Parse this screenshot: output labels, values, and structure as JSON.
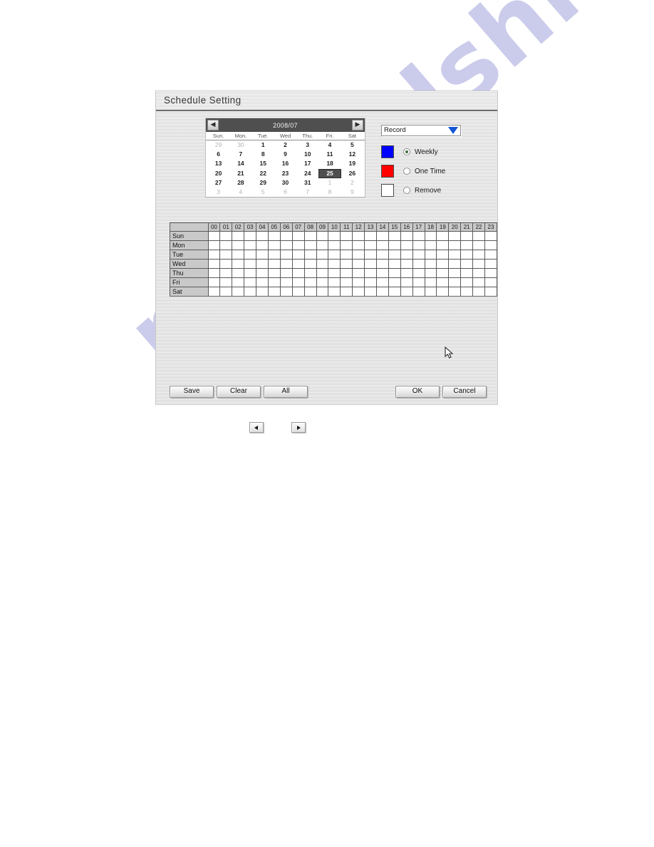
{
  "watermark": {
    "text": "manualshive.com"
  },
  "dialog": {
    "title": "Schedule Setting"
  },
  "calendar": {
    "prev_label": "◀",
    "next_label": "▶",
    "month_label": "2008/07",
    "day_headers": [
      "Sun.",
      "Mon.",
      "Tue.",
      "Wed",
      "Thu.",
      "Fri.",
      "Sat"
    ],
    "selected_day": 25,
    "weeks": [
      [
        {
          "d": "29",
          "muted": true
        },
        {
          "d": "30",
          "muted": true
        },
        {
          "d": "1"
        },
        {
          "d": "2"
        },
        {
          "d": "3"
        },
        {
          "d": "4"
        },
        {
          "d": "5"
        }
      ],
      [
        {
          "d": "6"
        },
        {
          "d": "7"
        },
        {
          "d": "8"
        },
        {
          "d": "9"
        },
        {
          "d": "10"
        },
        {
          "d": "11"
        },
        {
          "d": "12"
        }
      ],
      [
        {
          "d": "13"
        },
        {
          "d": "14"
        },
        {
          "d": "15"
        },
        {
          "d": "16"
        },
        {
          "d": "17"
        },
        {
          "d": "18"
        },
        {
          "d": "19"
        }
      ],
      [
        {
          "d": "20"
        },
        {
          "d": "21"
        },
        {
          "d": "22"
        },
        {
          "d": "23"
        },
        {
          "d": "24"
        },
        {
          "d": "25",
          "sel": true
        },
        {
          "d": "26"
        }
      ],
      [
        {
          "d": "27"
        },
        {
          "d": "28"
        },
        {
          "d": "29"
        },
        {
          "d": "30"
        },
        {
          "d": "31"
        },
        {
          "d": "1",
          "muted": true
        },
        {
          "d": "2",
          "muted": true
        }
      ],
      [
        {
          "d": "3",
          "muted": true
        },
        {
          "d": "4",
          "muted": true
        },
        {
          "d": "5",
          "muted": true
        },
        {
          "d": "6",
          "muted": true
        },
        {
          "d": "7",
          "muted": true
        },
        {
          "d": "8",
          "muted": true
        },
        {
          "d": "9",
          "muted": true
        }
      ]
    ]
  },
  "mode_select": {
    "value": "Record",
    "options": [
      "Record"
    ],
    "arrow_color": "#1456d6"
  },
  "legend": [
    {
      "label": "Weekly",
      "color": "#0000ff",
      "selected": true
    },
    {
      "label": "One Time",
      "color": "#ff0000",
      "selected": false
    },
    {
      "label": "Remove",
      "color": "#ffffff",
      "selected": false
    }
  ],
  "schedule_grid": {
    "hours": [
      "00",
      "01",
      "02",
      "03",
      "04",
      "05",
      "06",
      "07",
      "08",
      "09",
      "10",
      "11",
      "12",
      "13",
      "14",
      "15",
      "16",
      "17",
      "18",
      "19",
      "20",
      "21",
      "22",
      "23"
    ],
    "days": [
      "Sun",
      "Mon",
      "Tue",
      "Wed",
      "Thu",
      "Fri",
      "Sat"
    ],
    "cells": [
      [
        0,
        0,
        0,
        0,
        0,
        0,
        0,
        0,
        0,
        0,
        0,
        0,
        0,
        0,
        0,
        0,
        0,
        0,
        0,
        0,
        0,
        0,
        0,
        0
      ],
      [
        0,
        0,
        0,
        0,
        0,
        0,
        0,
        0,
        0,
        0,
        0,
        0,
        0,
        0,
        0,
        0,
        0,
        0,
        0,
        0,
        0,
        0,
        0,
        0
      ],
      [
        0,
        0,
        0,
        0,
        0,
        0,
        0,
        0,
        0,
        0,
        0,
        0,
        0,
        0,
        0,
        0,
        0,
        0,
        0,
        0,
        0,
        0,
        0,
        0
      ],
      [
        0,
        0,
        0,
        0,
        0,
        0,
        0,
        0,
        0,
        0,
        0,
        0,
        0,
        0,
        0,
        0,
        0,
        0,
        0,
        0,
        0,
        0,
        0,
        0
      ],
      [
        0,
        0,
        0,
        0,
        0,
        0,
        0,
        0,
        0,
        0,
        0,
        0,
        0,
        0,
        0,
        0,
        0,
        0,
        0,
        0,
        0,
        0,
        0,
        0
      ],
      [
        0,
        0,
        0,
        0,
        0,
        0,
        0,
        0,
        0,
        0,
        0,
        0,
        0,
        0,
        0,
        0,
        0,
        0,
        0,
        0,
        0,
        0,
        0,
        0
      ],
      [
        0,
        0,
        0,
        0,
        0,
        0,
        0,
        0,
        0,
        0,
        0,
        0,
        0,
        0,
        0,
        0,
        0,
        0,
        0,
        0,
        0,
        0,
        0,
        0
      ]
    ]
  },
  "buttons": {
    "save": "Save",
    "clear": "Clear",
    "all": "All",
    "ok": "OK",
    "cancel": "Cancel"
  },
  "steppers": {
    "prev": "◀",
    "next": "▶"
  }
}
